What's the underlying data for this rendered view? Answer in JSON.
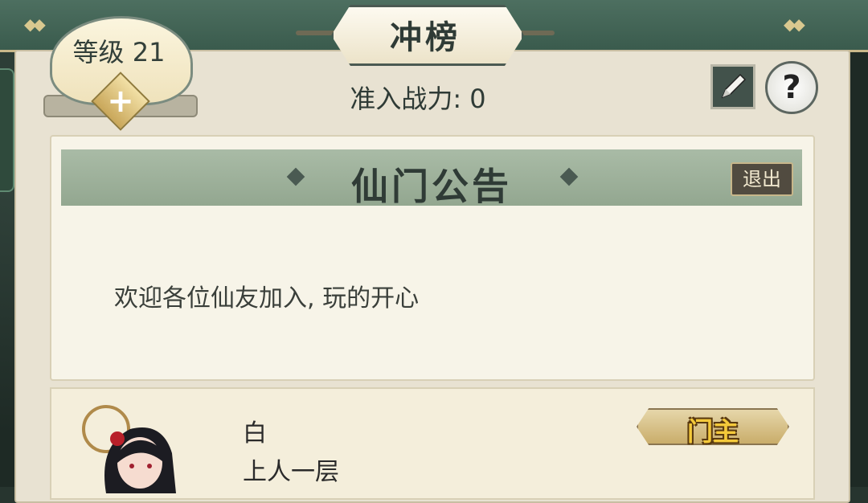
{
  "header": {
    "title": "冲榜"
  },
  "level": {
    "label": "等级 21",
    "plus": "+"
  },
  "power": {
    "text": "准入战力: 0"
  },
  "buttons": {
    "help": "?"
  },
  "notice": {
    "title": "仙门公告",
    "exit_label": "退出",
    "body": "欢迎各位仙友加入, 玩的开心"
  },
  "member": {
    "name": "白",
    "rank": "上人一层",
    "role": "门主"
  },
  "colors": {
    "panel_bg": "#e8e2d2",
    "header_green": "#9fb29c",
    "role_gold": "#f4c93a"
  }
}
